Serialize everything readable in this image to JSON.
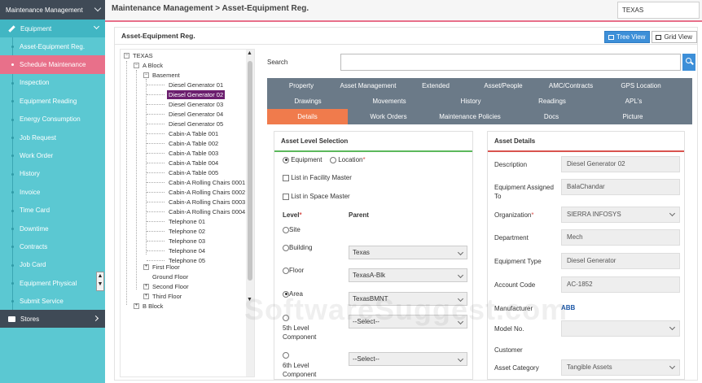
{
  "sidebar": {
    "header": "Maintenance Management",
    "section": "Equipment",
    "items": [
      {
        "label": "Asset-Equipment Reg.",
        "active": false
      },
      {
        "label": "Schedule Maintenance",
        "active": true
      },
      {
        "label": "Inspection",
        "active": false
      },
      {
        "label": "Equipment Reading",
        "active": false
      },
      {
        "label": "Energy Consumption",
        "active": false
      },
      {
        "label": "Job Request",
        "active": false
      },
      {
        "label": "Work Order",
        "active": false
      },
      {
        "label": "History",
        "active": false
      },
      {
        "label": "Invoice",
        "active": false
      },
      {
        "label": "Time Card",
        "active": false
      },
      {
        "label": "Downtime",
        "active": false
      },
      {
        "label": "Contracts",
        "active": false
      },
      {
        "label": "Job Card",
        "active": false
      },
      {
        "label": "Equipment Physical",
        "active": false
      },
      {
        "label": "Submit Service",
        "active": false
      }
    ],
    "stores": "Stores"
  },
  "topbar": {
    "breadcrumb": "Maintenance Management > Asset-Equipment Reg.",
    "site_value": "TEXAS"
  },
  "main": {
    "title": "Asset-Equipment Reg.",
    "tree_view": "Tree View",
    "grid_view": "Grid View"
  },
  "tree": {
    "root": "TEXAS",
    "block_a": "A Block",
    "basement": "Basement",
    "assets": [
      "Diesel Generator 01",
      "Diesel Generator 02",
      "Diesel Generator 03",
      "Diesel Generator 04",
      "Diesel Generator 05",
      "Cabin-A Table 001",
      "Cabin-A Table 002",
      "Cabin-A Table 003",
      "Cabin-A Table 004",
      "Cabin-A Table 005",
      "Cabin-A Rolling Chairs 0001",
      "Cabin-A Rolling Chairs 0002",
      "Cabin-A Rolling Chairs 0003",
      "Cabin-A Rolling Chairs 0004",
      "Telephone 01",
      "Telephone 02",
      "Telephone 03",
      "Telephone 04",
      "Telephone 05"
    ],
    "selected_index": 1,
    "floors": [
      "First Floor",
      "Ground Floor",
      "Second Floor",
      "Third Floor"
    ],
    "block_b": "B Block"
  },
  "search": {
    "label": "Search",
    "value": ""
  },
  "tabs": {
    "row1": [
      "Property",
      "Asset Management",
      "Extended",
      "Asset/People",
      "AMC/Contracts",
      "GPS Location"
    ],
    "row2": [
      "Drawings",
      "Movements",
      "History",
      "Readings",
      "APL's"
    ],
    "row3": [
      "Details",
      "Work Orders",
      "Maintenance Policies",
      "Docs",
      "Picture"
    ],
    "active": "Details"
  },
  "level_card": {
    "title": "Asset Level Selection",
    "equipment": "Equipment",
    "location": "Location",
    "list_facility": "List in Facility Master",
    "list_space": "List in Space Master",
    "level_header": "Level",
    "parent_header": "Parent",
    "rows": [
      {
        "level": "Site",
        "parent": "",
        "checked": false
      },
      {
        "level": "Building",
        "parent": "Texas",
        "checked": false
      },
      {
        "level": "Floor",
        "parent": "TexasA-Blk",
        "checked": false
      },
      {
        "level": "Area",
        "parent": "TexasBMNT",
        "checked": true
      },
      {
        "level": "5th Level Component",
        "parent": "--Select--",
        "checked": false
      },
      {
        "level": "6th Level Component",
        "parent": "--Select--",
        "checked": false
      }
    ]
  },
  "details_card": {
    "title": "Asset Details",
    "fields": [
      {
        "label": "Description",
        "value": "Diesel Generator 02"
      },
      {
        "label": "Equipment Assigned To",
        "value": "BalaChandar"
      },
      {
        "label": "Organization",
        "value": "SIERRA INFOSYS"
      },
      {
        "label": "Department",
        "value": "Mech"
      },
      {
        "label": "Equipment Type",
        "value": "Diesel Generator"
      },
      {
        "label": "Account Code",
        "value": "AC-1852"
      },
      {
        "label": "Manufacturer",
        "value": "ABB"
      },
      {
        "label": "Model No.",
        "value": ""
      },
      {
        "label": "Customer",
        "value": ""
      },
      {
        "label": "Asset Category",
        "value": "Tangible Assets"
      }
    ]
  },
  "watermark": "SoftwareSuggest.com"
}
